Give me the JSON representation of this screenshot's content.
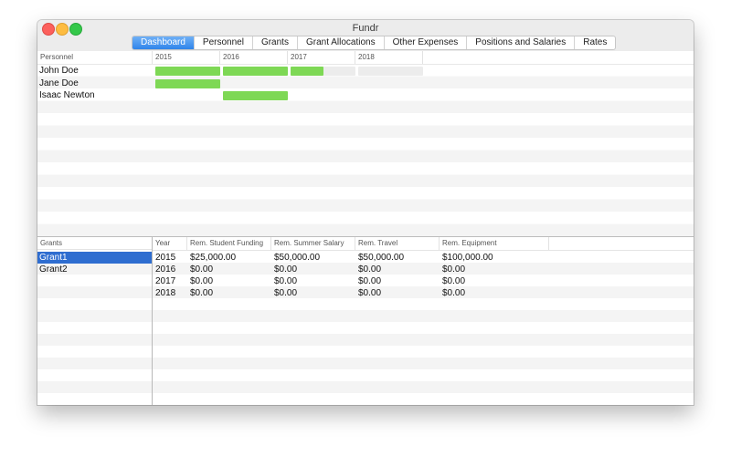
{
  "window": {
    "title": "Fundr"
  },
  "tabs": [
    "Dashboard",
    "Personnel",
    "Grants",
    "Grant Allocations",
    "Other Expenses",
    "Positions and Salaries",
    "Rates"
  ],
  "active_tab": "Dashboard",
  "personnel_table": {
    "columns": [
      "Personnel",
      "2015",
      "2016",
      "2017",
      "2018"
    ],
    "rows": [
      {
        "name": "John Doe",
        "allocation": [
          1.0,
          1.0,
          0.5,
          0.0
        ]
      },
      {
        "name": "Jane Doe",
        "allocation": [
          1.0,
          null,
          null,
          null
        ]
      },
      {
        "name": "Isaac Newton",
        "allocation": [
          null,
          1.0,
          null,
          null
        ]
      }
    ]
  },
  "grants_list": {
    "header": "Grants",
    "items": [
      "Grant1",
      "Grant2"
    ],
    "selected": "Grant1"
  },
  "remaining_table": {
    "columns": [
      "Year",
      "Rem. Student Funding",
      "Rem. Summer Salary",
      "Rem. Travel",
      "Rem. Equipment"
    ],
    "rows": [
      [
        "2015",
        "$25,000.00",
        "$50,000.00",
        "$50,000.00",
        "$100,000.00"
      ],
      [
        "2016",
        "$0.00",
        "$0.00",
        "$0.00",
        "$0.00"
      ],
      [
        "2017",
        "$0.00",
        "$0.00",
        "$0.00",
        "$0.00"
      ],
      [
        "2018",
        "$0.00",
        "$0.00",
        "$0.00",
        "$0.00"
      ]
    ]
  },
  "colors": {
    "accent": "#3d8fe8",
    "bar_fill": "#7ed855",
    "bar_track": "#ececec",
    "selection": "#2e6dd0"
  }
}
